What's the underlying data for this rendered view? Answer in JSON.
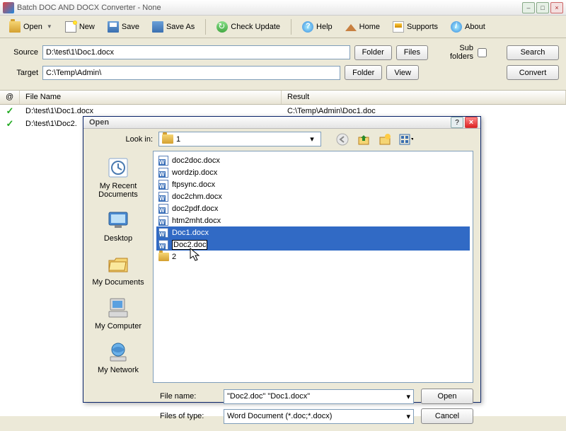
{
  "window": {
    "title": "Batch DOC AND DOCX Converter - None"
  },
  "toolbar": {
    "open": "Open",
    "new": "New",
    "save": "Save",
    "save_as": "Save As",
    "check_update": "Check Update",
    "help": "Help",
    "home": "Home",
    "supports": "Supports",
    "about": "About"
  },
  "form": {
    "source_label": "Source",
    "source_value": "D:\\test\\1\\Doc1.docx",
    "target_label": "Target",
    "target_value": "C:\\Temp\\Admin\\",
    "folder_btn": "Folder",
    "files_btn": "Files",
    "view_btn": "View",
    "subfolders_label": "Sub folders",
    "search_btn": "Search",
    "convert_btn": "Convert"
  },
  "list": {
    "col_at": "@",
    "col_filename": "File Name",
    "col_result": "Result",
    "rows": [
      {
        "file": "D:\\test\\1\\Doc1.docx",
        "result": "C:\\Temp\\Admin\\Doc1.doc"
      },
      {
        "file": "D:\\test\\1\\Doc2.",
        "result": ""
      }
    ]
  },
  "dialog": {
    "title": "Open",
    "lookin_label": "Look in:",
    "lookin_value": "1",
    "places": {
      "recent": "My Recent Documents",
      "desktop": "Desktop",
      "mydocs": "My Documents",
      "mycomp": "My Computer",
      "mynet": "My Network"
    },
    "files": [
      {
        "name": "doc2doc.docx",
        "type": "docx"
      },
      {
        "name": "wordzip.docx",
        "type": "docx"
      },
      {
        "name": "ftpsync.docx",
        "type": "docx"
      },
      {
        "name": "doc2chm.docx",
        "type": "docx"
      },
      {
        "name": "doc2pdf.docx",
        "type": "docx"
      },
      {
        "name": "htm2mht.docx",
        "type": "docx"
      },
      {
        "name": "Doc1.docx",
        "type": "docx",
        "selected": true
      },
      {
        "name": "Doc2.doc",
        "type": "docx",
        "selected": true,
        "renaming": true
      },
      {
        "name": "2",
        "type": "folder"
      }
    ],
    "filename_label": "File name:",
    "filename_value": "\"Doc2.doc\" \"Doc1.docx\"",
    "filetype_label": "Files of type:",
    "filetype_value": "Word Document (*.doc;*.docx)",
    "open_btn": "Open",
    "cancel_btn": "Cancel"
  }
}
